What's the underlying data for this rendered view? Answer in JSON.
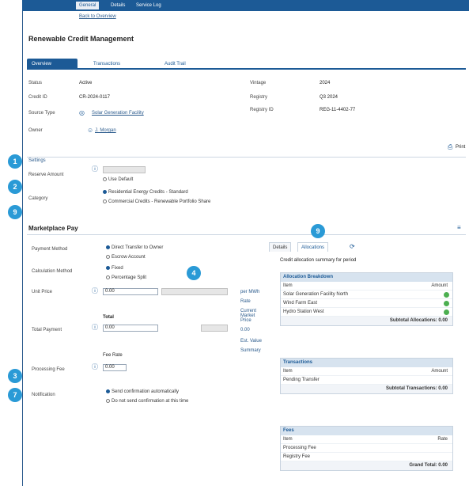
{
  "top_tabs": [
    "General",
    "Details",
    "Service Log"
  ],
  "sub_link": "Back to Overview",
  "page_title": "Renewable Credit Management",
  "tabs": [
    "Overview",
    "Transactions",
    "Audit Trail"
  ],
  "info": {
    "status_label": "Status",
    "status_value": "Active",
    "credit_id_label": "Credit ID",
    "credit_id_value": "CR-2024-0117",
    "source_type_label": "Source Type",
    "source_type_value": "Solar Generation Facility",
    "owner_label": "Owner",
    "owner_value": "J. Morgan",
    "vintage_label": "Vintage",
    "vintage_value": "2024",
    "registry_label": "Registry",
    "registry_value": "Q3 2024",
    "registry_id_label": "Registry ID",
    "registry_id_value": "REG-11-4402-77"
  },
  "print_label": "Print",
  "settings": {
    "title": "Settings",
    "reserve_label": "Reserve Amount",
    "reserve_value": "",
    "reserve_checkbox": "Use Default",
    "category_label": "Category",
    "category_opt1": "Residential Energy Credits - Standard",
    "category_opt2": "Commercial Credits - Renewable Portfolio Share"
  },
  "marketplace": {
    "title": "Marketplace Pay",
    "payment_method_label": "Payment Method",
    "payment_opt1": "Direct Transfer to Owner",
    "payment_opt2": "Escrow Account",
    "calc_method_label": "Calculation Method",
    "calc_opt1": "Fixed",
    "calc_opt2": "Percentage Split",
    "unit_price_label": "Unit Price",
    "unit_price_value": "0.00",
    "unit_price_side": "per MWh",
    "unit_price_side2": "Rate",
    "unit_price_side3": "Current Market Price",
    "total_label": "Total Payment",
    "total_value": "0.00",
    "total_head": "Total",
    "total_side1": "0.00",
    "total_side2": "Est. Value",
    "fee_label": "Processing Fee",
    "fee_head": "Fee Rate",
    "fee_value": "0.00",
    "notify_label": "Notification",
    "notify_opt1": "Send confirmation automatically",
    "notify_opt2": "Do not send confirmation at this time",
    "side_note": "Summary"
  },
  "right_tabs": [
    "Details",
    "Allocations"
  ],
  "right_summary": "Credit allocation summary for period",
  "panel1": {
    "head": "Allocation Breakdown",
    "col_name": "Item",
    "col_amount": "Amount",
    "rows": [
      "Solar Generation Facility North",
      "Wind Farm East",
      "Hydro Station West"
    ],
    "total": "Subtotal Allocations: 0.00"
  },
  "panel2": {
    "head": "Transactions",
    "col_name": "Item",
    "col_amount": "Amount",
    "rows": [
      "Pending Transfer"
    ],
    "total": "Subtotal Transactions: 0.00"
  },
  "panel3": {
    "head": "Fees",
    "col_name": "Item",
    "col_amount": "Rate",
    "rows": [
      "Processing Fee",
      "Registry Fee"
    ],
    "total": "Grand Total: 0.00"
  },
  "badges": [
    "1",
    "2",
    "9",
    "9",
    "4",
    "3",
    "7"
  ]
}
